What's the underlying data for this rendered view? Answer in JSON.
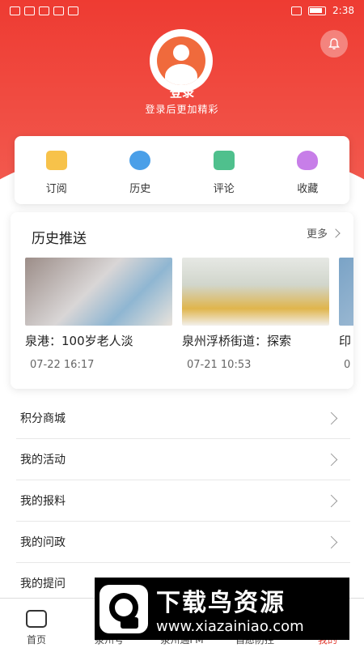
{
  "status_bar": {
    "time": "2:38"
  },
  "header": {
    "login_title": "登录",
    "login_subtitle": "登录后更加精彩"
  },
  "quick_actions": [
    {
      "label": "订阅",
      "icon": "subscribe-icon"
    },
    {
      "label": "历史",
      "icon": "history-icon"
    },
    {
      "label": "评论",
      "icon": "comment-icon"
    },
    {
      "label": "收藏",
      "icon": "favorite-icon"
    }
  ],
  "history_push": {
    "title": "历史推送",
    "more_label": "更多",
    "items": [
      {
        "title": "泉港：100岁老人淡",
        "time": "07-22 16:17"
      },
      {
        "title": "泉州浮桥街道：探索",
        "time": "07-21 10:53"
      },
      {
        "title": "印",
        "time": "0"
      }
    ]
  },
  "menu": [
    {
      "label": "积分商城"
    },
    {
      "label": "我的活动"
    },
    {
      "label": "我的报料"
    },
    {
      "label": "我的问政"
    },
    {
      "label": "我的提问"
    }
  ],
  "tabbar": [
    {
      "label": "首页"
    },
    {
      "label": "泉州号"
    },
    {
      "label": "泉州通FM"
    },
    {
      "label": "自愿防控"
    },
    {
      "label": "我的"
    }
  ],
  "watermark": {
    "title": "下载鸟资源",
    "url": "www.xiazainiao.com"
  },
  "colors": {
    "brand_red": "#ee3b32",
    "active_tab": "#e13d33"
  }
}
